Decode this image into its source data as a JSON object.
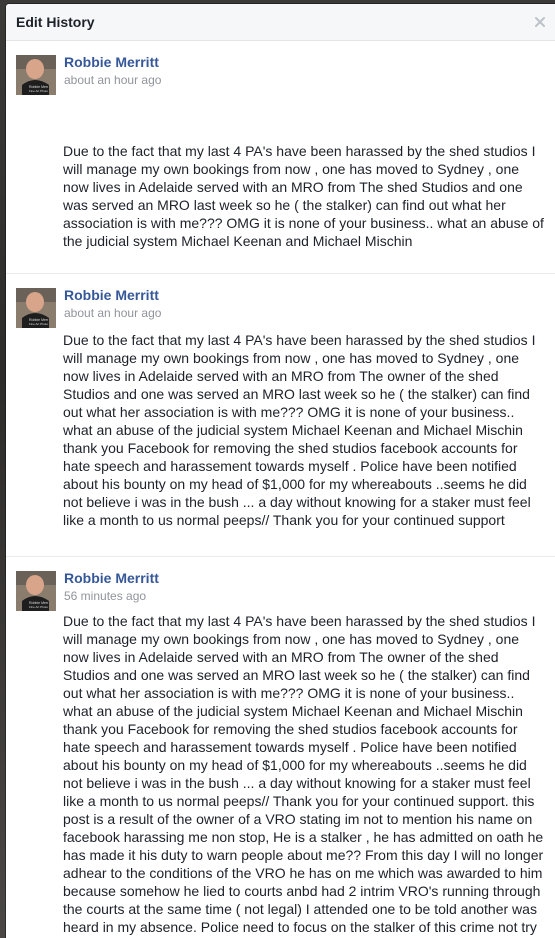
{
  "dialog": {
    "title": "Edit History",
    "close_icon": "close-icon"
  },
  "entries": [
    {
      "author": "Robbie Merritt",
      "timestamp": "about an hour ago",
      "text": "Due to the fact that my last 4 PA's have been harassed by the shed studios I will manage my own bookings from now , one has moved to Sydney , one now lives in Adelaide served with an MRO from The shed Studios and one was served an MRO last week so he ( the stalker) can find out what her association is with me??? OMG it is none of your business.. what an abuse of the judicial system Michael Keenan and Michael Mischin"
    },
    {
      "author": "Robbie Merritt",
      "timestamp": "about an hour ago",
      "text": "Due to the fact that my last 4 PA's have been harassed by the shed studios I will manage my own bookings from now , one has moved to Sydney , one now lives in Adelaide served with an MRO from The owner of the shed Studios and one was served an MRO last week so he ( the stalker) can find out what her association is with me??? OMG it is none of your business.. what an abuse of the judicial system Michael Keenan and Michael Mischin thank you Facebook for removing the shed studios facebook accounts for hate speech and harassement towards myself . Police have been notified about his bounty on my head of $1,000 for my whereabouts ..seems he did not believe i was in the bush ... a day without knowing for a staker must feel like a month to us normal peeps// Thank you for your continued support"
    },
    {
      "author": "Robbie Merritt",
      "timestamp": "56 minutes ago",
      "text": "Due to the fact that my last 4 PA's have been harassed by the shed studios I will manage my own bookings from now , one has moved to Sydney , one now lives in Adelaide served with an MRO from The owner of the shed Studios and one was served an MRO last week so he ( the stalker) can find out what her association is with me??? OMG it is none of your business.. what an abuse of the judicial system Michael Keenan and Michael Mischin thank you Facebook for removing the shed studios facebook accounts for hate speech and harassement towards myself . Police have been notified about his bounty on my head of $1,000 for my whereabouts ..seems he did not believe i was in the bush ... a day without knowing for a staker must feel like a month to us normal peeps// Thank you for your continued support. this post is a result of the owner of a VRO stating im not to mention his name on facebook harassing me non stop, He is a stalker , he has admitted on oath he has made it his duty to warn people about me?? From this day I will no longer adhear to the conditions of the VRO he has on me which was awarded to him because somehow he lied to courts anbd had 2 intrim VRO's running through the courts at the same time ( not legal) I attended one to be told another was heard in my absence. Police need to focus on the stalker of this crime not try harass the Victim."
    }
  ]
}
